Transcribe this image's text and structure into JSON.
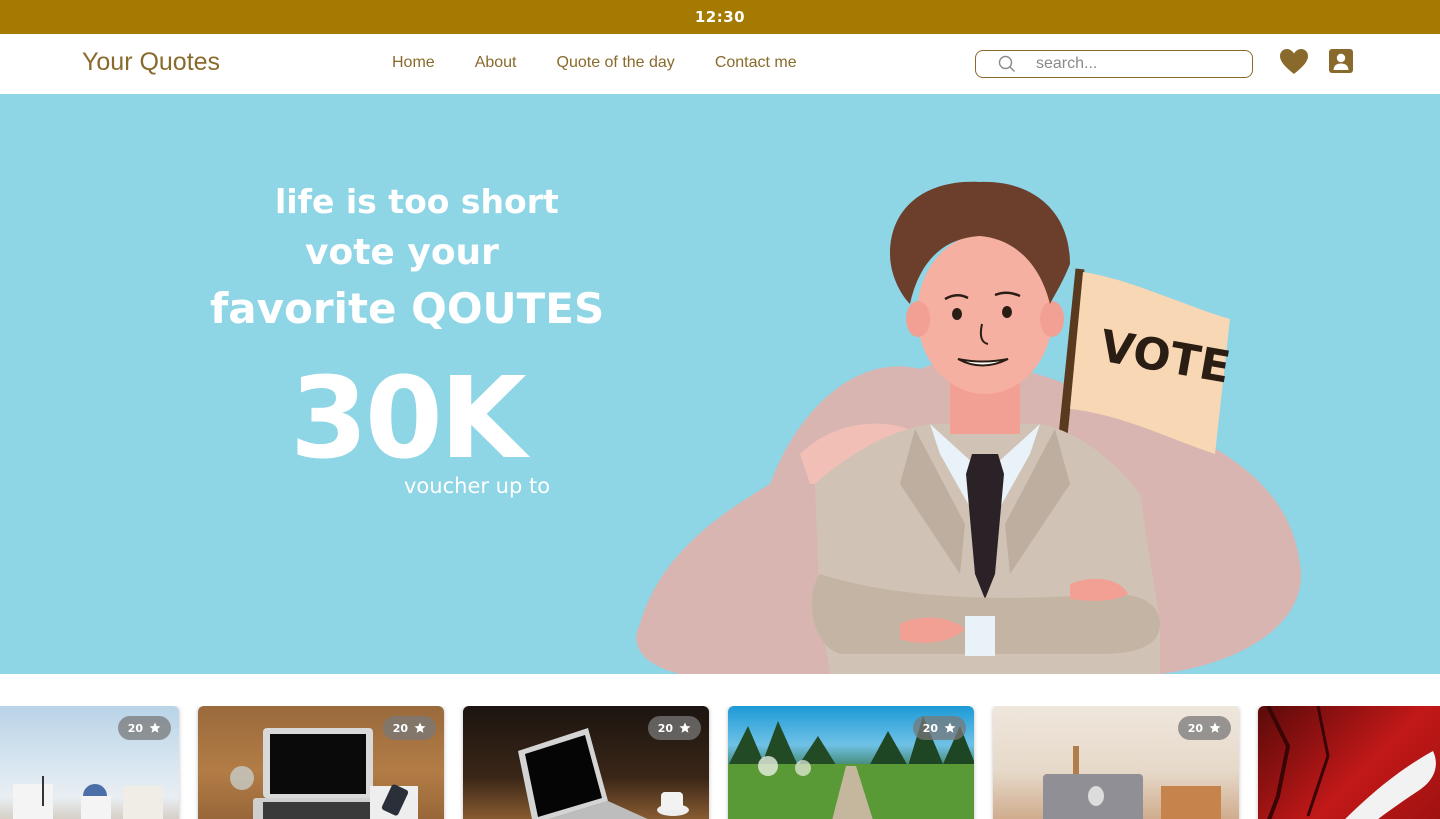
{
  "status": {
    "time": "12:30"
  },
  "nav": {
    "logo": "Your Quotes",
    "links": [
      "Home",
      "About",
      "Quote of the day",
      "Contact me"
    ],
    "search_placeholder": "search..."
  },
  "hero": {
    "line1": "life is too short",
    "line2": "vote your",
    "line3": "favorite QOUTES",
    "big_number": "30K",
    "sub": "voucher up to",
    "flag_text": "VOTE"
  },
  "cards": [
    {
      "rating": "20"
    },
    {
      "rating": "20"
    },
    {
      "rating": "20"
    },
    {
      "rating": "20"
    },
    {
      "rating": "20"
    },
    {
      "rating": ""
    }
  ],
  "colors": {
    "status_bar": "#a57a00",
    "brand": "#8a6a2c",
    "hero_bg": "#8ed5e5"
  }
}
